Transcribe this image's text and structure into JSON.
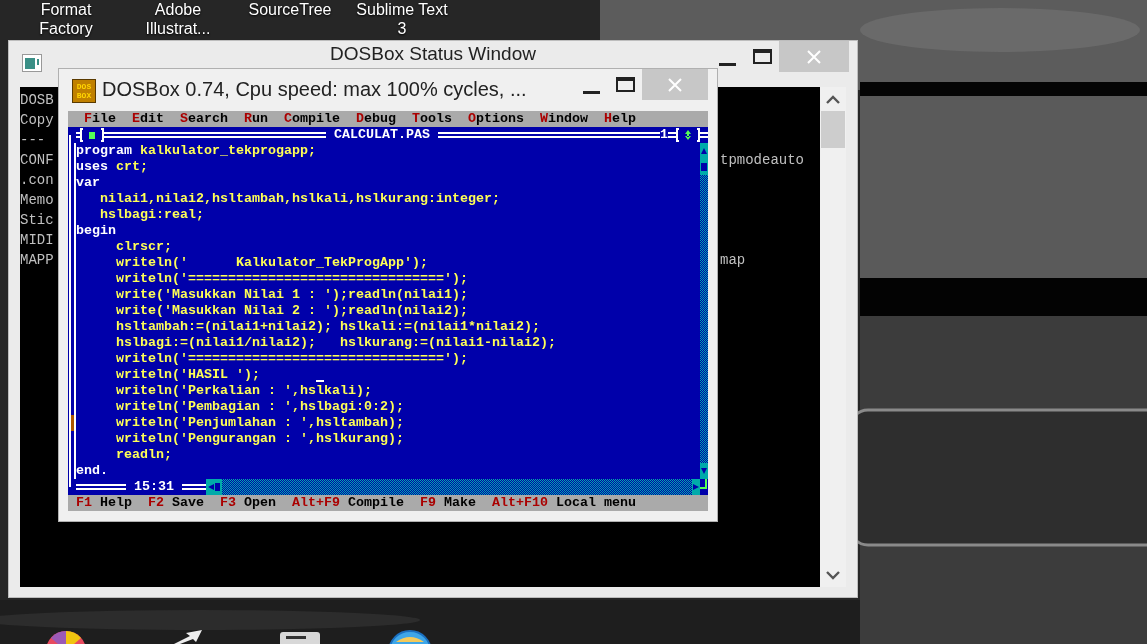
{
  "desktop": {
    "icons": [
      {
        "lines": [
          "Format",
          "Factory"
        ]
      },
      {
        "lines": [
          "Adobe",
          "Illustrat..."
        ]
      },
      {
        "lines": [
          "SourceTree"
        ]
      },
      {
        "lines": [
          "Sublime Text",
          "3"
        ]
      }
    ]
  },
  "status_window": {
    "title": "DOSBox Status Window",
    "lines": [
      {
        "left": "DOSB"
      },
      {
        "left": "Copy"
      },
      {
        "left": "---"
      },
      {
        "left": "CONF",
        "right": "tpmodeauto"
      },
      {
        "left": ".con"
      },
      {
        "left": "Memo"
      },
      {
        "left": "Stic"
      },
      {
        "left": "MIDI"
      },
      {
        "left": "MAPP",
        "right": "map"
      }
    ]
  },
  "dosbox_window": {
    "logo_lines": [
      "DOS",
      "BOX"
    ],
    "title": "DOSBox 0.74, Cpu speed: max 100% cycles, ...",
    "menu": [
      {
        "label": "File"
      },
      {
        "label": "Edit"
      },
      {
        "label": "Search"
      },
      {
        "label": "Run"
      },
      {
        "label": "Compile"
      },
      {
        "label": "Debug"
      },
      {
        "label": "Tools"
      },
      {
        "label": "Options"
      },
      {
        "label": "Window"
      },
      {
        "label": "Help"
      }
    ],
    "editor": {
      "filename": "CALCULAT.PAS",
      "window_number": "1",
      "cursor_position": "15:31",
      "lines": [
        {
          "marked": false,
          "segments": [
            {
              "kind": "keyword",
              "text": "program"
            },
            {
              "kind": "text",
              "text": " kalkulator_tekprogapp;"
            }
          ]
        },
        {
          "marked": false,
          "segments": [
            {
              "kind": "keyword",
              "text": "uses"
            },
            {
              "kind": "text",
              "text": " crt;"
            }
          ]
        },
        {
          "marked": false,
          "segments": [
            {
              "kind": "keyword",
              "text": "var"
            }
          ]
        },
        {
          "marked": false,
          "segments": [
            {
              "kind": "text",
              "text": "   nilai1,nilai2,hsltambah,hslkali,hslkurang:integer;"
            }
          ]
        },
        {
          "marked": false,
          "segments": [
            {
              "kind": "text",
              "text": "   hslbagi:real;"
            }
          ]
        },
        {
          "marked": false,
          "segments": [
            {
              "kind": "keyword",
              "text": "begin"
            }
          ]
        },
        {
          "marked": false,
          "segments": [
            {
              "kind": "text",
              "text": "     clrscr;"
            }
          ]
        },
        {
          "marked": false,
          "segments": [
            {
              "kind": "text",
              "text": "     writeln('      Kalkulator_TekProgApp');"
            }
          ]
        },
        {
          "marked": false,
          "segments": [
            {
              "kind": "text",
              "text": "     writeln('================================');"
            }
          ]
        },
        {
          "marked": false,
          "segments": [
            {
              "kind": "text",
              "text": "     write('Masukkan Nilai 1 : ');readln(nilai1);"
            }
          ]
        },
        {
          "marked": false,
          "segments": [
            {
              "kind": "text",
              "text": "     write('Masukkan Nilai 2 : ');readln(nilai2);"
            }
          ]
        },
        {
          "marked": false,
          "segments": [
            {
              "kind": "text",
              "text": "     hsltambah:=(nilai1+nilai2); hslkali:=(nilai1*nilai2);"
            }
          ]
        },
        {
          "marked": false,
          "segments": [
            {
              "kind": "text",
              "text": "     hslbagi:=(nilai1/nilai2);   hslkurang:=(nilai1-nilai2);"
            }
          ]
        },
        {
          "marked": false,
          "segments": [
            {
              "kind": "text",
              "text": "     writeln('================================');"
            }
          ]
        },
        {
          "marked": false,
          "segments": [
            {
              "kind": "text",
              "text": "     writeln('HASIL ');"
            }
          ]
        },
        {
          "marked": false,
          "segments": [
            {
              "kind": "text",
              "text": "     writeln('Perkalian : ',hslkali);"
            }
          ]
        },
        {
          "marked": false,
          "segments": [
            {
              "kind": "text",
              "text": "     writeln('Pembagian : ',hslbagi:0:2);"
            }
          ]
        },
        {
          "marked": true,
          "segments": [
            {
              "kind": "text",
              "text": "     writeln('Penjumlahan : ',hsltambah);"
            }
          ]
        },
        {
          "marked": false,
          "segments": [
            {
              "kind": "text",
              "text": "     writeln('Pengurangan : ',hslkurang);"
            }
          ]
        },
        {
          "marked": false,
          "segments": [
            {
              "kind": "text",
              "text": "     readln;"
            }
          ]
        },
        {
          "marked": false,
          "segments": [
            {
              "kind": "keyword",
              "text": "end."
            }
          ]
        }
      ]
    },
    "status_line": [
      {
        "key": "F1",
        "label": "Help"
      },
      {
        "key": "F2",
        "label": "Save"
      },
      {
        "key": "F3",
        "label": "Open"
      },
      {
        "key": "Alt+F9",
        "label": "Compile"
      },
      {
        "key": "F9",
        "label": "Make"
      },
      {
        "key": "Alt+F10",
        "label": "Local menu"
      }
    ]
  }
}
